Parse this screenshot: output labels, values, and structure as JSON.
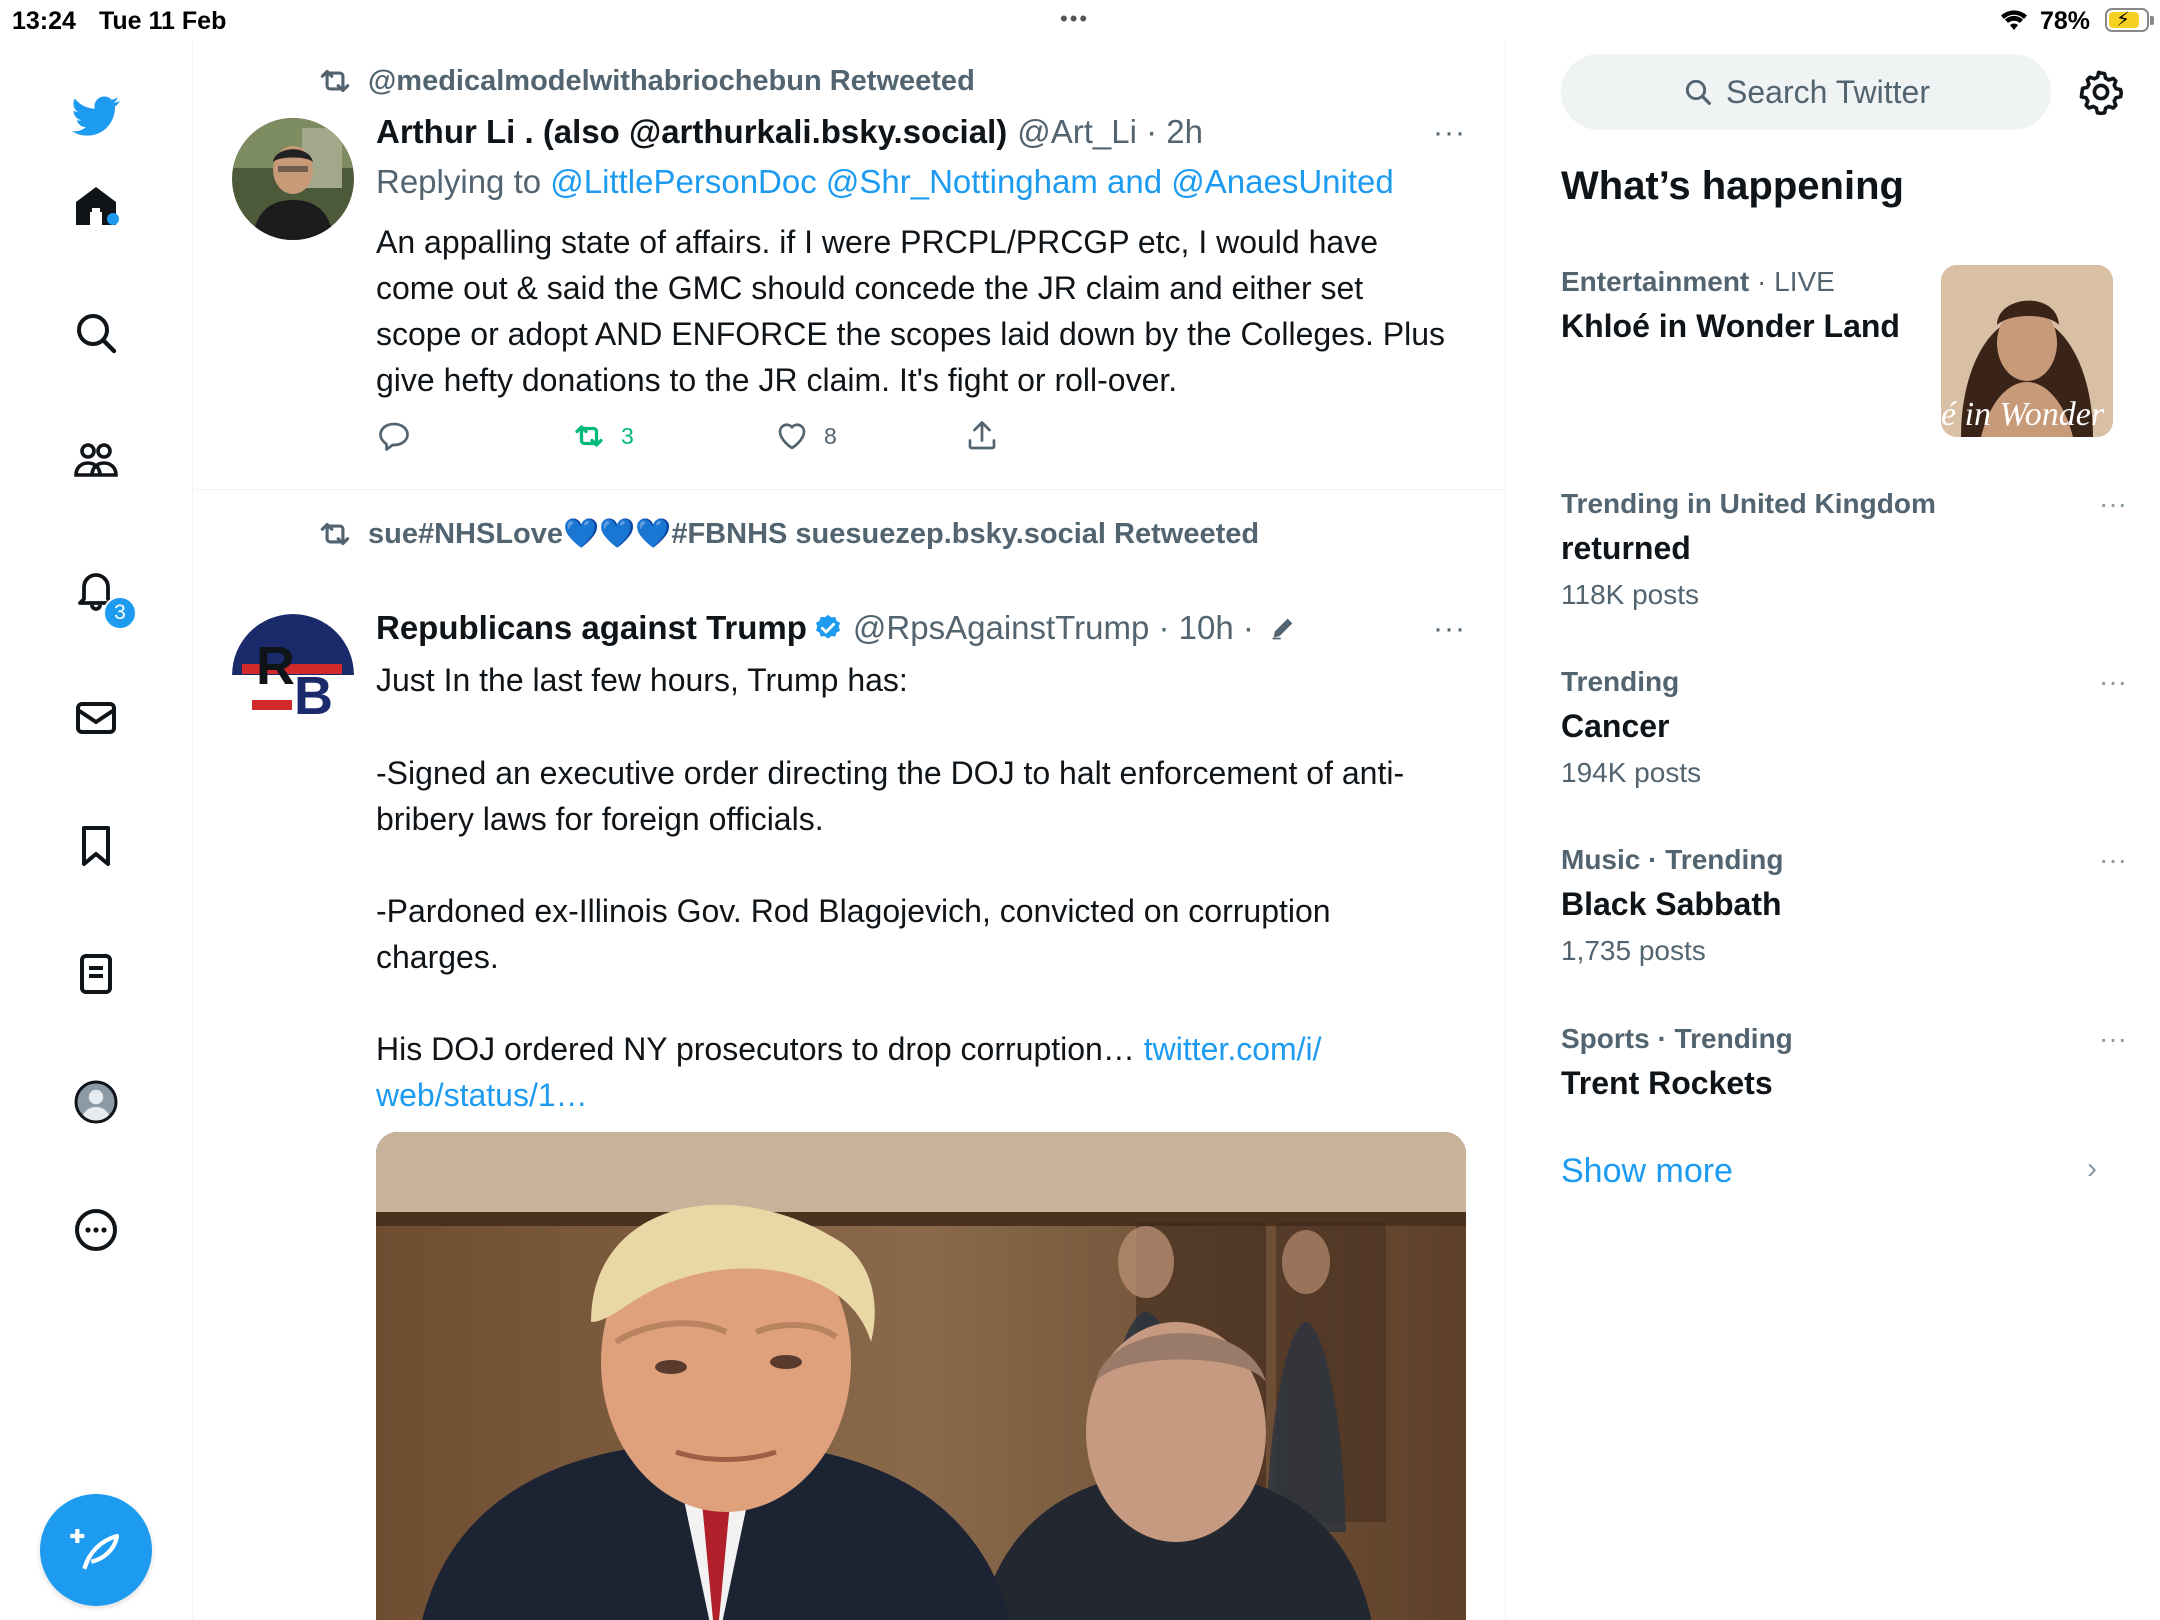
{
  "status_bar": {
    "time": "13:24",
    "date": "Tue 11 Feb",
    "grabber": "•••",
    "battery": "78%",
    "battery_level": 0.78
  },
  "nav": {
    "items": [
      "twitter-logo",
      "home",
      "search",
      "communities",
      "notifications",
      "messages",
      "bookmarks",
      "lists",
      "profile",
      "more"
    ],
    "notifications_badge": "3",
    "accent_color": "#1d9bf0"
  },
  "tweets": [
    {
      "retweeted_by": "@medicalmodelwithabriochebun Retweeted",
      "name": "Arthur Li . (also @arthurkali.bsky.social)",
      "meta": "@Art_Li · 2h",
      "replying_prefix": "Replying to",
      "replying_to": "@LittlePersonDoc @Shr_Nottingham and @AnaesUnited",
      "text": "An appalling state of affairs. if I were PRCPL/PRCGP etc, I would have come out & said the GMC should concede the JR claim and either set scope or adopt AND ENFORCE the scopes laid down by the Colleges. Plus give hefty donations to the JR claim. It's fight or roll-over.",
      "retweets": "3",
      "likes": "8",
      "more": "···"
    },
    {
      "retweeted_by": "sue#NHSLove💙💙💙#FBNHS suesuezep.bsky.social Retweeted",
      "name": "Republicans against Trump",
      "meta": "@RpsAgainstTrump · 10h ·",
      "text_p1": "Just In the last few hours, Trump has:",
      "text_p2": "-Signed an executive order directing the DOJ to halt enforcement of anti-bribery laws for foreign officials.",
      "text_p3": "-Pardoned ex-Illinois Gov. Rod Blagojevich, convicted on corruption charges.",
      "text_p4": "His DOJ ordered NY prosecutors to drop corruption…",
      "link": "twitter.com/i/web/status/1…",
      "link_part1": "twitter.com/i/",
      "link_part2": "web/status/1…",
      "more": "···"
    }
  ],
  "sidebar": {
    "search_placeholder": "Search Twitter",
    "title": "What’s happening",
    "trends": [
      {
        "context": "Entertainment",
        "live": " · LIVE",
        "topic": "Khloé in Wonder Land",
        "thumb_caption": "é in Wonder L"
      },
      {
        "context": "Trending in United Kingdom",
        "topic": "returned",
        "count": "118K posts"
      },
      {
        "context": "Trending",
        "topic": "Cancer",
        "count": "194K posts"
      },
      {
        "context": "Music · Trending",
        "topic": "Black Sabbath",
        "count": "1,735 posts"
      },
      {
        "context": "Sports · Trending",
        "topic": "Trent Rockets"
      }
    ],
    "show_more": "Show more",
    "more_dots": "···",
    "chevron": "›"
  }
}
